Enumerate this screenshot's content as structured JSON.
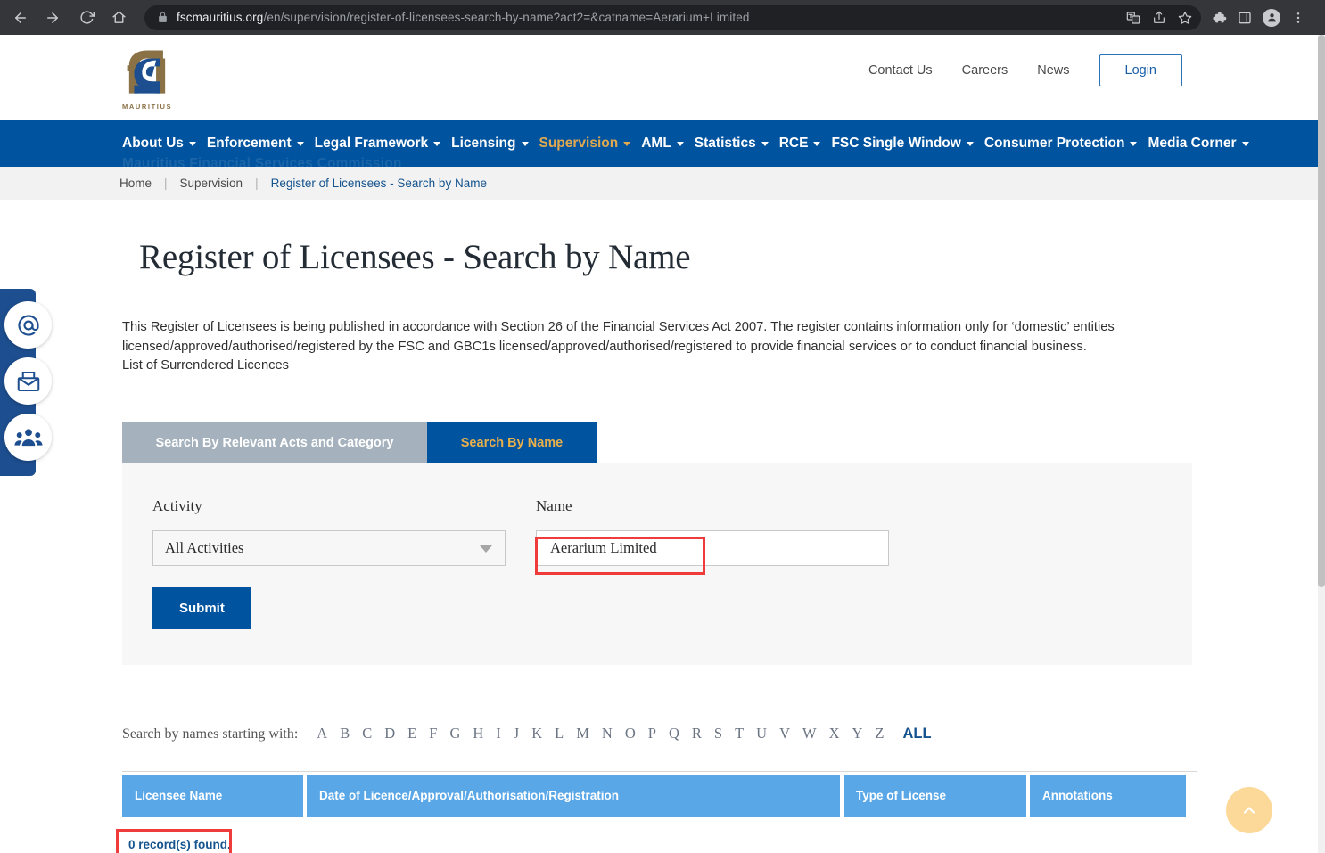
{
  "browser": {
    "url_host": "fscmauritius.org",
    "url_path": "/en/supervision/register-of-licensees-search-by-name?act2=&catname=Aerarium+Limited",
    "back_icon": "back-arrow-icon",
    "forward_icon": "forward-arrow-icon",
    "reload_icon": "reload-icon",
    "home_icon": "home-icon",
    "lock_icon": "lock-icon",
    "translate_icon": "translate-icon",
    "share_icon": "share-icon",
    "bookmark_icon": "star-icon",
    "extensions_icon": "puzzle-icon",
    "sidepanel_icon": "side-panel-icon",
    "profile_icon": "profile-avatar-icon",
    "menu_icon": "three-dot-menu-icon"
  },
  "header": {
    "logo_word": "MAURITIUS",
    "top_links": [
      "Contact Us",
      "Careers",
      "News"
    ],
    "login_label": "Login"
  },
  "mainnav": {
    "items": [
      {
        "label": "About Us",
        "active": false,
        "caret": true
      },
      {
        "label": "Enforcement",
        "active": false,
        "caret": true
      },
      {
        "label": "Legal Framework",
        "active": false,
        "caret": true
      },
      {
        "label": "Licensing",
        "active": false,
        "caret": true
      },
      {
        "label": "Supervision",
        "active": true,
        "caret": true
      },
      {
        "label": "AML",
        "active": false,
        "caret": true
      },
      {
        "label": "Statistics",
        "active": false,
        "caret": true
      },
      {
        "label": "RCE",
        "active": false,
        "caret": true
      },
      {
        "label": "FSC Single Window",
        "active": false,
        "caret": true
      },
      {
        "label": "Consumer Protection",
        "active": false,
        "caret": true
      },
      {
        "label": "Media Corner",
        "active": false,
        "caret": true
      }
    ],
    "ghost_text": "Mauritius Financial Services Commission"
  },
  "breadcrumb": {
    "home": "Home",
    "section": "Supervision",
    "current": "Register of Licensees - Search by Name",
    "separator": "|"
  },
  "main": {
    "title": "Register of Licensees - Search by Name",
    "intro_line1": "This Register of Licensees is being published in accordance with Section 26 of the Financial Services Act 2007. The register contains information only for ‘domestic’ entities",
    "intro_line2": "licensed/approved/authorised/registered by the FSC and GBC1s licensed/approved/authorised/registered to provide financial services or to conduct financial business.",
    "intro_line3": "List of Surrendered Licences"
  },
  "tabs": {
    "inactive_label": "Search By Relevant Acts and Category",
    "active_label": "Search By Name"
  },
  "form": {
    "activity_label": "Activity",
    "activity_value": "All Activities",
    "activity_caret": "chevron-down-icon",
    "name_label": "Name",
    "name_value": "Aerarium Limited",
    "name_placeholder": "",
    "submit_label": "Submit"
  },
  "alphabet": {
    "label": "Search by names starting with:",
    "letters": [
      "A",
      "B",
      "C",
      "D",
      "E",
      "F",
      "G",
      "H",
      "I",
      "J",
      "K",
      "L",
      "M",
      "N",
      "O",
      "P",
      "Q",
      "R",
      "S",
      "T",
      "U",
      "V",
      "W",
      "X",
      "Y",
      "Z"
    ],
    "all_label": "ALL"
  },
  "table": {
    "headers": [
      "Licensee Name",
      "Date of Licence/Approval/Authorisation/Registration",
      "Type of License",
      "Annotations"
    ],
    "rows": [],
    "record_count_text": "0 record(s) found."
  },
  "social_rail": {
    "items": [
      {
        "name": "at-sign-icon",
        "title": "Email us"
      },
      {
        "name": "envelope-icon",
        "title": "Newsletter"
      },
      {
        "name": "people-group-icon",
        "title": "Community"
      }
    ]
  },
  "back_to_top": {
    "icon": "chevron-up-icon"
  },
  "colors": {
    "brand_blue": "#00539f",
    "accent_gold": "#e0a94f",
    "table_header_blue": "#5aa7e8",
    "highlight_red": "#ef3b39",
    "link_blue": "#14538e",
    "to_top_bg": "#fcd999"
  }
}
